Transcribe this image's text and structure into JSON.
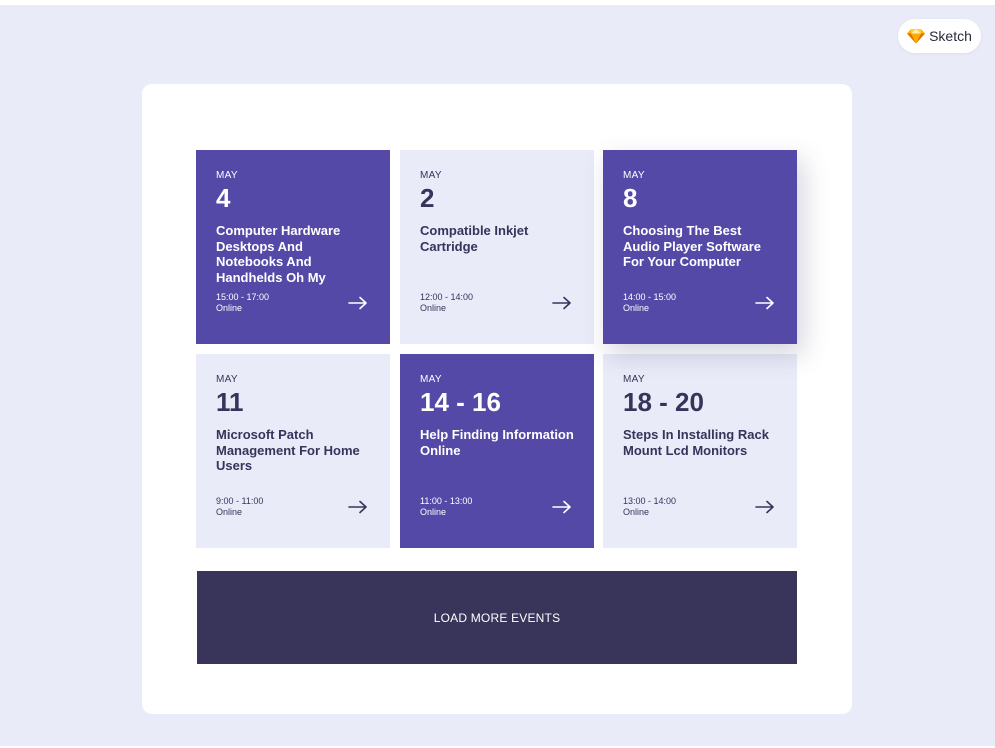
{
  "badge": {
    "label": "Sketch",
    "icon": "sketch-diamond-icon"
  },
  "colors": {
    "backdrop": "#e9ebf8",
    "purple_tile": "#5549a8",
    "light_tile": "#e9ebf8",
    "button": "#393459",
    "dark_text": "#36345a"
  },
  "events": [
    {
      "month": "MAY",
      "day": "4",
      "title": "Computer Hardware Desktops And Notebooks And Handhelds Oh My",
      "time": "15:00 - 17:00",
      "location": "Online",
      "style": "purple"
    },
    {
      "month": "MAY",
      "day": "2",
      "title": "Compatible Inkjet Cartridge",
      "time": "12:00 - 14:00",
      "location": "Online",
      "style": "light"
    },
    {
      "month": "MAY",
      "day": "8",
      "title": "Choosing The Best Audio Player Software For Your Computer",
      "time": "14:00 - 15:00",
      "location": "Online",
      "style": "purple"
    },
    {
      "month": "MAY",
      "day": "11",
      "title": "Microsoft Patch Management For Home Users",
      "time": "9:00 - 11:00",
      "location": "Online",
      "style": "light"
    },
    {
      "month": "MAY",
      "day": "14 - 16",
      "title": "Help Finding Information Online",
      "time": "11:00 - 13:00",
      "location": "Online",
      "style": "purple"
    },
    {
      "month": "MAY",
      "day": "18 - 20",
      "title": "Steps In Installing Rack Mount Lcd Monitors",
      "time": "13:00 - 14:00",
      "location": "Online",
      "style": "light"
    }
  ],
  "load_more": {
    "label": "LOAD MORE EVENTS"
  }
}
